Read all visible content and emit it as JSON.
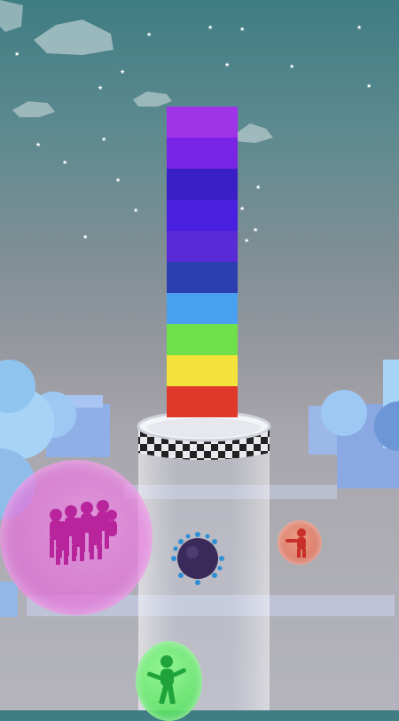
{
  "scene": {
    "sky_top": "#3f7c83",
    "sky_bottom": "#b4b4bd",
    "tower_blocks": [
      {
        "color": "#a033e8"
      },
      {
        "color": "#7a24e6"
      },
      {
        "color": "#3a1fc7"
      },
      {
        "color": "#4a20e0"
      },
      {
        "color": "#5a2ad6"
      },
      {
        "color": "#2b3fb0"
      },
      {
        "color": "#4aa0f0"
      },
      {
        "color": "#6ee04a"
      },
      {
        "color": "#f3e23a"
      },
      {
        "color": "#e0382a"
      }
    ],
    "pink_bubble_color": "#e070e0",
    "green_bubble_color": "#4ce05a",
    "red_bubble_color": "#e0704a",
    "spike_ball_color": "#3a2a5a"
  }
}
